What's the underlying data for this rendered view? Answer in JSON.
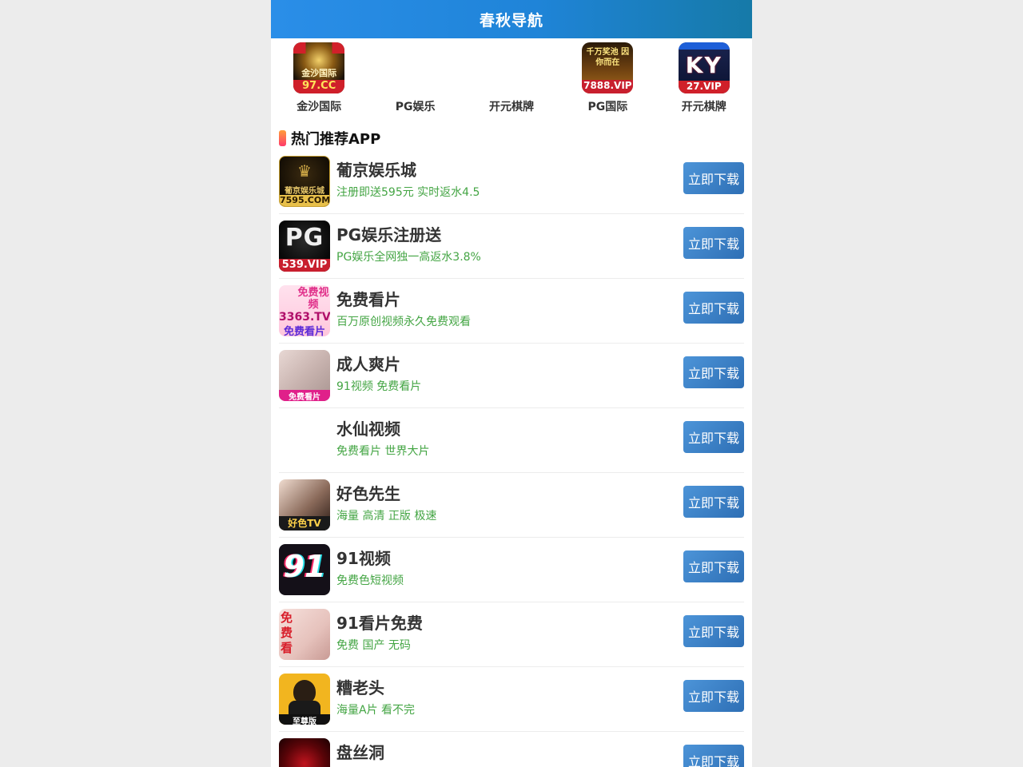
{
  "header": {
    "title": "春秋导航"
  },
  "top_apps": [
    {
      "label": "金沙国际",
      "icon": "jinsha-app-icon",
      "badge": "97.CC",
      "sub": "金沙国际"
    },
    {
      "label": "PG娱乐",
      "icon": "pg-app-icon"
    },
    {
      "label": "开元棋牌",
      "icon": "kaiyuan-app-icon"
    },
    {
      "label": "PG国际",
      "icon": "pg-intl-app-icon",
      "badge": "7888.VIP",
      "sub": "千万奖池 因你而在"
    },
    {
      "label": "开元棋牌",
      "icon": "ky-app-icon",
      "badge": "27.VIP",
      "sub": "KY"
    }
  ],
  "section": {
    "title": "热门推荐APP"
  },
  "apps": [
    {
      "name": "葡京娱乐城",
      "desc": "注册即送595元 实时返水4.5",
      "button": "立即下载",
      "icon_text": "7595.COM",
      "icon_sub": "葡京娱乐城"
    },
    {
      "name": "PG娱乐注册送",
      "desc": "PG娱乐全网独一高返水3.8%",
      "button": "立即下载",
      "icon_text": "539.VIP",
      "icon_sub": "PG"
    },
    {
      "name": "免费看片",
      "desc": "百万原创视频永久免费观看",
      "button": "立即下载",
      "icon_text": "3363.TV",
      "icon_sub": "免费视频",
      "icon_sub2": "免费看片"
    },
    {
      "name": "成人爽片",
      "desc": "91视频 免费看片",
      "button": "立即下载",
      "icon_text": "免费看片"
    },
    {
      "name": "水仙视频",
      "desc": "免费看片 世界大片",
      "button": "立即下载"
    },
    {
      "name": "好色先生",
      "desc": "海量 高清 正版 极速",
      "button": "立即下载",
      "icon_text": "好色TV"
    },
    {
      "name": "91视频",
      "desc": "免费色短视频",
      "button": "立即下载",
      "icon_text": "91"
    },
    {
      "name": "91看片免费",
      "desc": "免费 国产 无码",
      "button": "立即下载",
      "icon_text": "免费看"
    },
    {
      "name": "糟老头",
      "desc": "海量A片 看不完",
      "button": "立即下载",
      "icon_text": "至尊版"
    },
    {
      "name": "盘丝洞",
      "desc": "",
      "button": "立即下载"
    }
  ],
  "colors": {
    "header_gradient": [
      "#2a8ee8",
      "#167aa8"
    ],
    "button": "#3d80c6",
    "desc_green": "#44a544",
    "section_bar": [
      "#ff9d3a",
      "#ff3b6b"
    ]
  }
}
